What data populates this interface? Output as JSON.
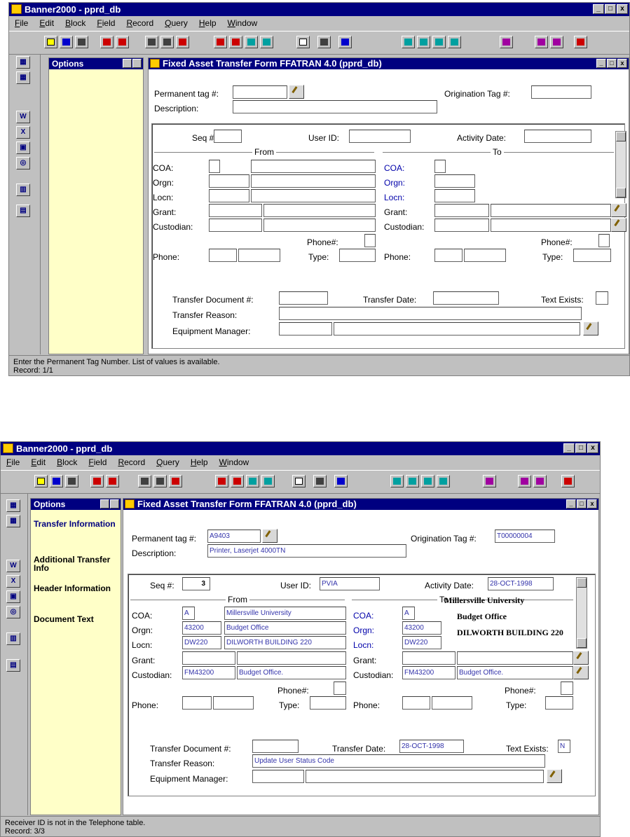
{
  "app": {
    "title": "Banner2000 - pprd_db",
    "menus": [
      "File",
      "Edit",
      "Block",
      "Field",
      "Record",
      "Query",
      "Help",
      "Window"
    ],
    "window_controls": [
      "_",
      "□",
      "x"
    ]
  },
  "options": {
    "title": "Options",
    "items": [
      "Transfer Information",
      "Additional Transfer Info",
      "Header Information",
      "Document Text"
    ]
  },
  "form": {
    "title": "Fixed Asset Transfer Form  FFATRAN  4.0  (pprd_db)",
    "labels": {
      "permanent_tag": "Permanent tag #:",
      "origination_tag": "Origination Tag #:",
      "description": "Description:",
      "seq": "Seq #:",
      "user_id": "User ID:",
      "activity_date": "Activity Date:",
      "from": "From",
      "to": "To",
      "coa": "COA:",
      "orgn": "Orgn:",
      "locn": "Locn:",
      "grant": "Grant:",
      "custodian": "Custodian:",
      "phone_num": "Phone#:",
      "phone": "Phone:",
      "type": "Type:",
      "transfer_document": "Transfer Document #:",
      "transfer_date": "Transfer Date:",
      "text_exists": "Text Exists:",
      "transfer_reason": "Transfer Reason:",
      "equipment_manager": "Equipment Manager:"
    }
  },
  "screen1": {
    "status_line1": "Enter the Permanent Tag Number.  List of values is available.",
    "status_line2": "Record: 1/1"
  },
  "screen2": {
    "values": {
      "permanent_tag": "A9403",
      "origination_tag": "T00000004",
      "description": "Printer, Laserjet 4000TN",
      "seq": "3",
      "user_id": "PVIA",
      "activity_date": "28-OCT-1998",
      "from_coa": "A",
      "from_coa_desc": "Millersville University",
      "from_orgn": "43200",
      "from_orgn_desc": "Budget Office",
      "from_locn": "DW220",
      "from_locn_desc": "DILWORTH BUILDING 220",
      "from_custodian": "FM43200",
      "from_custodian_desc": "Budget Office.",
      "to_coa": "A",
      "to_coa_desc": "Millersville University",
      "to_orgn": "43200",
      "to_orgn_desc": "Budget Office",
      "to_locn": "DW220",
      "to_locn_desc": "DILWORTH BUILDING 220",
      "to_custodian": "FM43200",
      "to_custodian_desc": "Budget Office.",
      "transfer_date": "28-OCT-1998",
      "text_exists": "N",
      "transfer_reason": "Update User Status Code"
    },
    "status_line1": "Receiver ID is not in the Telephone table.",
    "status_line2": "Record: 3/3"
  }
}
